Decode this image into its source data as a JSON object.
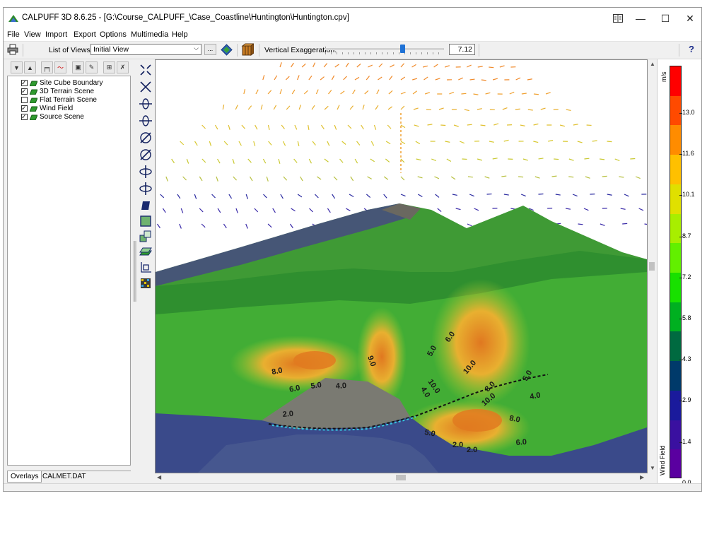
{
  "window": {
    "title": "CALPUFF 3D 8.6.25 - [G:\\Course_CALPUFF_\\Case_Coastline\\Huntington\\Huntington.cpv]",
    "controls": [
      "restore-icon",
      "minimize-icon",
      "maximize-icon",
      "close-icon"
    ]
  },
  "menu": [
    "File",
    "View",
    "Import",
    "Export",
    "Options",
    "Multimedia",
    "Help"
  ],
  "toolbar": {
    "print_icon": "printer-icon",
    "list_of_views_label": "List of Views:",
    "list_of_views_value": "Initial View",
    "browse_label": "...",
    "vertical_exaggeration_label": "Vertical Exaggeration:",
    "vertical_exaggeration_value": "7.12",
    "vertical_exaggeration_slider_fraction": 0.66,
    "help_label": "?"
  },
  "tree": {
    "items": [
      {
        "label": "Site Cube Boundary",
        "checked": true
      },
      {
        "label": "3D Terrain Scene",
        "checked": true
      },
      {
        "label": "Flat Terrain Scene",
        "checked": false
      },
      {
        "label": "Wind Field",
        "checked": true
      },
      {
        "label": "Source Scene",
        "checked": true
      }
    ],
    "tabs": [
      "Overlays",
      "CALMET.DAT"
    ]
  },
  "scene": {
    "contour_labels": [
      "8.0",
      "6.0",
      "5.0",
      "4.0",
      "2.0",
      "9.0",
      "4.0",
      "10.0",
      "5.0",
      "6.0",
      "10.0",
      "8.0",
      "10.0",
      "4.0",
      "5.0",
      "8.0",
      "6.0",
      "5.0",
      "2.0",
      "2.0"
    ]
  },
  "legend": {
    "unit": "m/s",
    "name": "Wind Field",
    "ticks": [
      "13.0",
      "11.6",
      "10.1",
      "8.7",
      "7.2",
      "5.8",
      "4.3",
      "2.9",
      "1.4",
      "0.0"
    ],
    "colors": [
      "#ff0000",
      "#ff4a00",
      "#ff8c00",
      "#ffc000",
      "#e0e000",
      "#a8ee00",
      "#62f000",
      "#18e000",
      "#00b020",
      "#006a40",
      "#003a6a",
      "#1a1a9c",
      "#3a10a0",
      "#5a00a0"
    ]
  }
}
